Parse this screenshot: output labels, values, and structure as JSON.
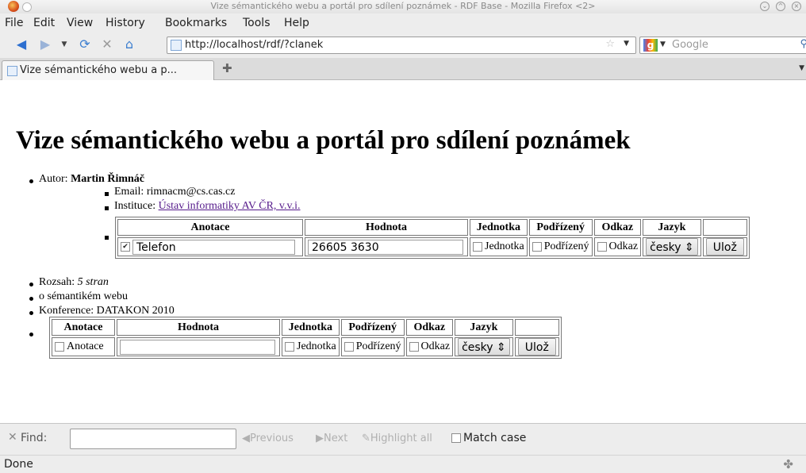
{
  "window": {
    "title": "Vize sémantického webu a portál pro sdílení poznámek - RDF Base - Mozilla Firefox <2>"
  },
  "menubar": {
    "file": "File",
    "edit": "Edit",
    "view": "View",
    "history": "History",
    "bookmarks": "Bookmarks",
    "tools": "Tools",
    "help": "Help"
  },
  "navbar": {
    "url": "http://localhost/rdf/?clanek",
    "search_placeholder": "Google"
  },
  "tabs": [
    {
      "label": "Vize sémantického webu a p..."
    }
  ],
  "page": {
    "heading": "Vize sémantického webu a portál pro sdílení poznámek",
    "author_label": "Autor:",
    "author_name": "Martin Řimnáč",
    "email": "Email: rimnacm@cs.cas.cz",
    "institution_label": "Instituce:",
    "institution_link": "Ústav informatiky AV ČR, v.v.i.",
    "rozsah_label": "Rozsah:",
    "rozsah_value": "5 stran",
    "semantic": "o sémantikém webu",
    "konference": "Konference: DATAKON 2010"
  },
  "table_headers": [
    "Anotace",
    "Hodnota",
    "Jednotka",
    "Podřízený",
    "Odkaz",
    "Jazyk"
  ],
  "table1": {
    "anotace_value": "Telefon",
    "anotace_checked": true,
    "hodnota_value": "26605 3630",
    "jednotka": "Jednotka",
    "podrizeny": "Podřízený",
    "odkaz": "Odkaz",
    "jazyk": "česky",
    "save": "Ulož"
  },
  "table2": {
    "anotace": "Anotace",
    "hodnota_value": "",
    "jednotka": "Jednotka",
    "podrizeny": "Podřízený",
    "odkaz": "Odkaz",
    "jazyk": "česky",
    "save": "Ulož"
  },
  "findbar": {
    "label": "Find:",
    "previous": "Previous",
    "next": "Next",
    "highlight": "Highlight all",
    "match_case": "Match case"
  },
  "status": {
    "text": "Done"
  }
}
